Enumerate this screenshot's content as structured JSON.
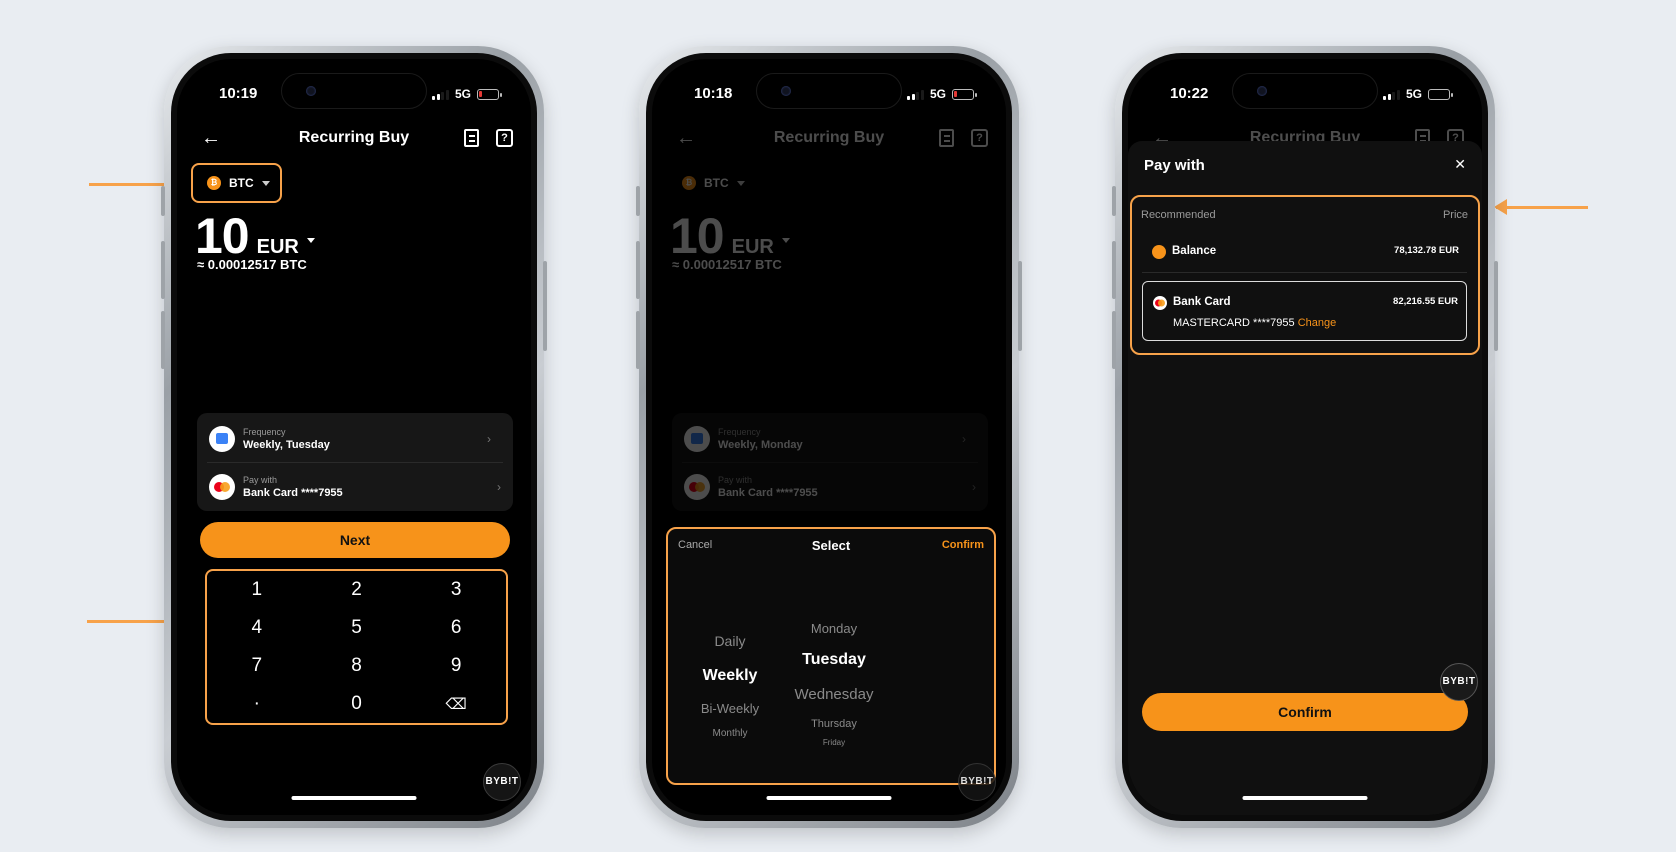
{
  "colors": {
    "accent": "#f7931a",
    "highlight": "#f7a24a",
    "background": "#e9edf2"
  },
  "screen1": {
    "status": {
      "time": "10:19",
      "network": "5G"
    },
    "header": {
      "title": "Recurring Buy"
    },
    "asset": {
      "symbol": "BTC",
      "icon": "btc-coin-icon"
    },
    "amount": {
      "value": "10",
      "currency": "EUR"
    },
    "approx": "≈ 0.00012517 BTC",
    "frequency": {
      "label": "Frequency",
      "value": "Weekly, Tuesday"
    },
    "pay_with": {
      "label": "Pay with",
      "value": "Bank Card ****7955"
    },
    "next_label": "Next",
    "keypad": [
      "1",
      "2",
      "3",
      "4",
      "5",
      "6",
      "7",
      "8",
      "9",
      "·",
      "0",
      "⌫"
    ],
    "brand": "BYB!T"
  },
  "screen2": {
    "status": {
      "time": "10:18",
      "network": "5G"
    },
    "header": {
      "title": "Recurring Buy"
    },
    "asset": {
      "symbol": "BTC"
    },
    "amount": {
      "value": "10",
      "currency": "EUR"
    },
    "approx": "≈ 0.00012517 BTC",
    "frequency": {
      "label": "Frequency",
      "value": "Weekly, Monday"
    },
    "pay_with": {
      "label": "Pay with",
      "value": "Bank Card ****7955"
    },
    "picker": {
      "cancel": "Cancel",
      "title": "Select",
      "confirm": "Confirm",
      "frequencies": [
        "Daily",
        "Weekly",
        "Bi-Weekly",
        "Monthly"
      ],
      "selected_frequency": "Weekly",
      "days": [
        "Monday",
        "Tuesday",
        "Wednesday",
        "Thursday",
        "Friday"
      ],
      "selected_day": "Tuesday"
    },
    "brand": "BYB!T"
  },
  "screen3": {
    "status": {
      "time": "10:22",
      "network": "5G"
    },
    "header": {
      "title": "Recurring Buy"
    },
    "sheet": {
      "title": "Pay with",
      "recommended": "Recommended",
      "price": "Price",
      "options": [
        {
          "name": "Balance",
          "price": "78,132.78 EUR"
        },
        {
          "name": "Bank Card",
          "price": "82,216.55 EUR",
          "detail": "MASTERCARD ****7955",
          "change": "Change"
        }
      ],
      "confirm": "Confirm"
    },
    "brand": "BYB!T"
  }
}
